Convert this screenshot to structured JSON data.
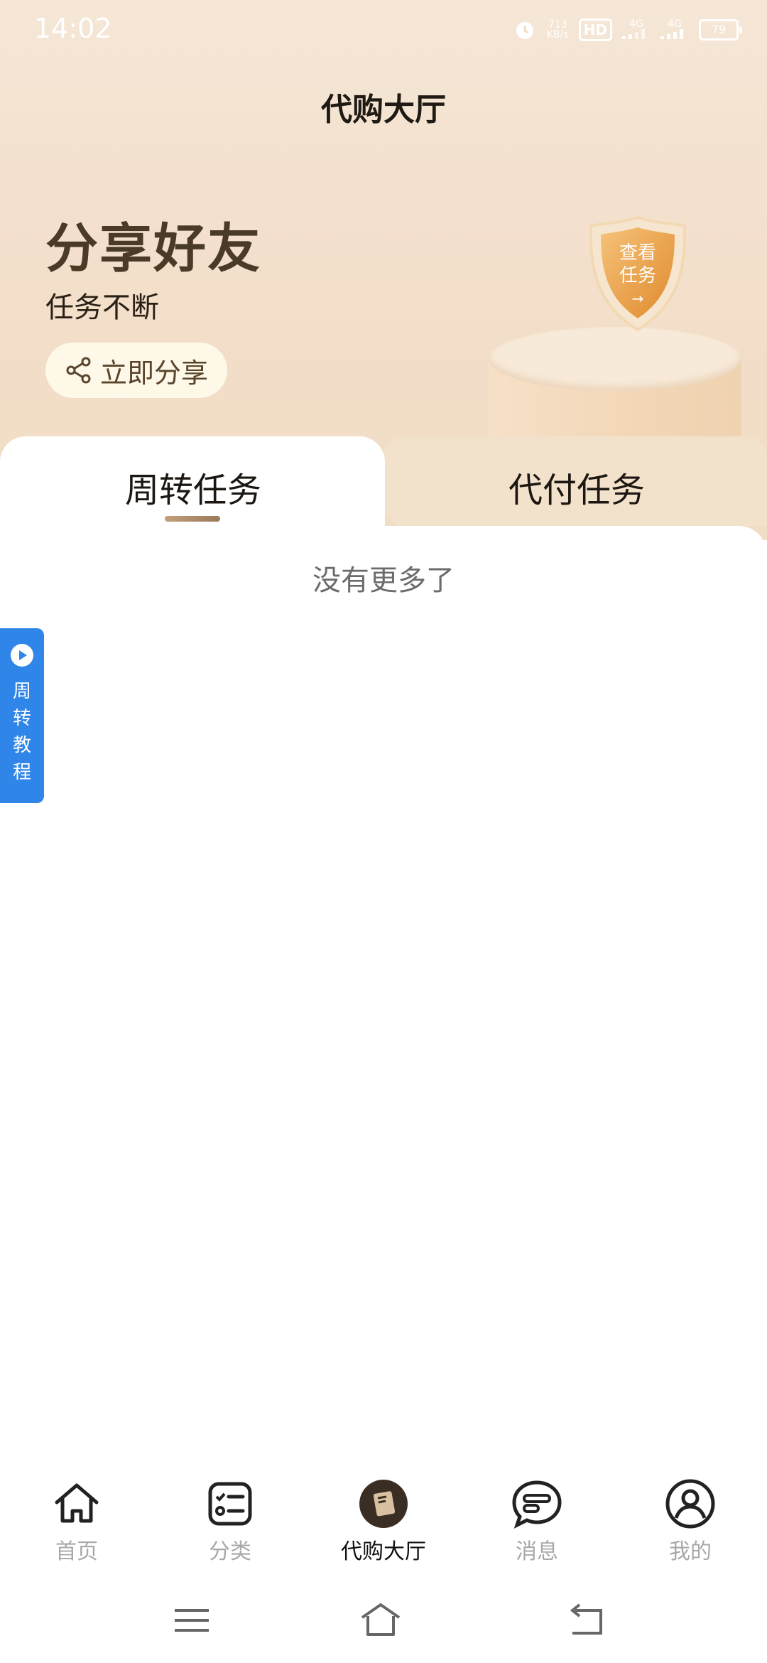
{
  "status_bar": {
    "time": "14:02",
    "net_speed": "713",
    "net_unit": "KB/s",
    "hd": "HD",
    "signal1": "4G",
    "signal2": "4G",
    "battery": "79"
  },
  "header": {
    "title": "代购大厅"
  },
  "hero": {
    "title": "分享好友",
    "subtitle": "任务不断",
    "share_button": "立即分享",
    "badge_line1": "查看",
    "badge_line2": "任务",
    "badge_arrow": "→"
  },
  "tabs": [
    {
      "label": "周转任务",
      "active": true
    },
    {
      "label": "代付任务",
      "active": false
    }
  ],
  "content": {
    "empty_text": "没有更多了"
  },
  "side_button": {
    "label": "周转教程"
  },
  "bottom_nav": [
    {
      "label": "首页",
      "icon": "home-icon"
    },
    {
      "label": "分类",
      "icon": "category-icon"
    },
    {
      "label": "代购大厅",
      "icon": "purchase-hall-icon",
      "active": true
    },
    {
      "label": "消息",
      "icon": "message-icon"
    },
    {
      "label": "我的",
      "icon": "profile-icon"
    }
  ],
  "colors": {
    "accent_blue": "#2f86e8",
    "hero_bg": "#f3dfca",
    "brown_text": "#4a3a28"
  }
}
